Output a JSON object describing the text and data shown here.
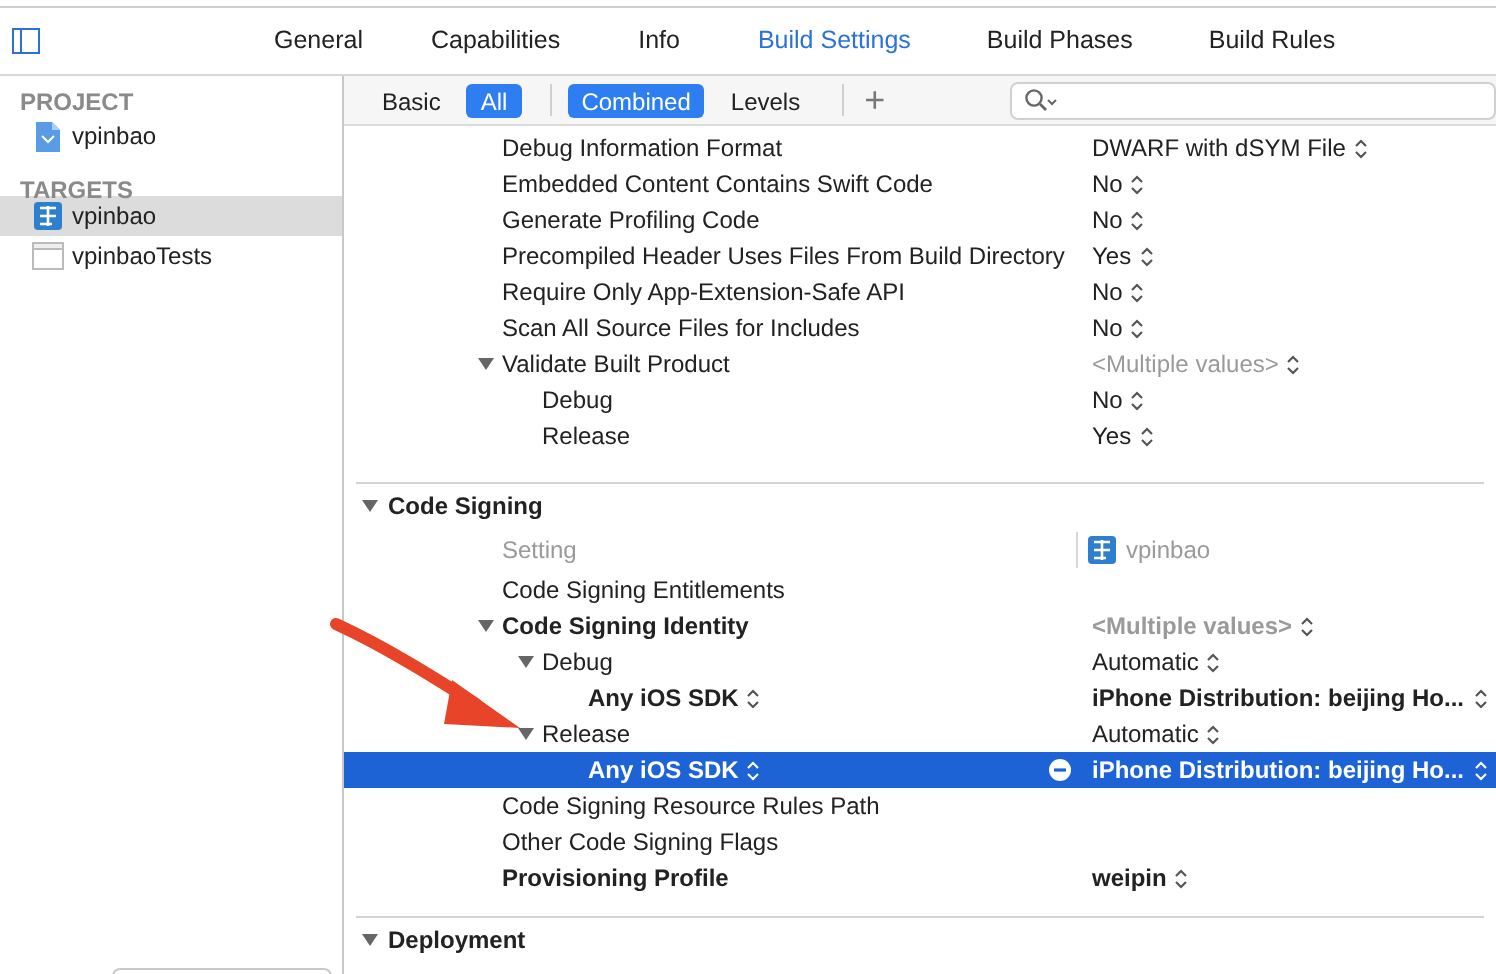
{
  "tabs": [
    {
      "label": "General",
      "selected": false
    },
    {
      "label": "Capabilities",
      "selected": false
    },
    {
      "label": "Info",
      "selected": false
    },
    {
      "label": "Build Settings",
      "selected": true
    },
    {
      "label": "Build Phases",
      "selected": false
    },
    {
      "label": "Build Rules",
      "selected": false
    }
  ],
  "sidebar": {
    "groups": [
      {
        "title": "PROJECT",
        "items": [
          {
            "label": "vpinbao",
            "kind": "project",
            "selected": false
          }
        ]
      },
      {
        "title": "TARGETS",
        "items": [
          {
            "label": "vpinbao",
            "kind": "app",
            "selected": true
          },
          {
            "label": "vpinbaoTests",
            "kind": "tests",
            "selected": false
          }
        ]
      }
    ]
  },
  "filter_bar": {
    "groups": [
      [
        {
          "label": "Basic",
          "selected": false
        },
        {
          "label": "All",
          "selected": true
        }
      ],
      [
        {
          "label": "Combined",
          "selected": true
        },
        {
          "label": "Levels",
          "selected": false
        }
      ]
    ],
    "add_button": "+"
  },
  "sections": [
    {
      "rows": [
        {
          "label": "Debug Information Format",
          "value": "DWARF with dSYM File",
          "selected": false
        },
        {
          "label": "Embedded Content Contains Swift Code",
          "value": "No",
          "selected": false
        },
        {
          "label": "Generate Profiling Code",
          "value": "No",
          "selected": false
        },
        {
          "label": "Precompiled Header Uses Files From Build Directory",
          "value": "Yes",
          "selected": false
        },
        {
          "label": "Require Only App-Extension-Safe API",
          "value": "No",
          "selected": false
        },
        {
          "label": "Scan All Source Files for Includes",
          "value": "No",
          "selected": false
        },
        {
          "label": "Validate Built Product",
          "value": "<Multiple values>",
          "muted": true,
          "expanded": true,
          "selected": false,
          "children": [
            {
              "label": "Debug",
              "value": "No",
              "selected": false
            },
            {
              "label": "Release",
              "value": "Yes",
              "selected": false
            }
          ]
        }
      ]
    },
    {
      "title": "Code Signing",
      "expanded": true,
      "columns": {
        "setting": "Setting",
        "target": "vpinbao"
      },
      "rows": [
        {
          "label": "Code Signing Entitlements",
          "selected": false
        },
        {
          "label": "Code Signing Identity",
          "bold": true,
          "value": "<Multiple values>",
          "muted": true,
          "expanded": true,
          "selected": false,
          "children": [
            {
              "label": "Debug",
              "value": "Automatic",
              "expanded": true,
              "selected": false,
              "children": [
                {
                  "label": "Any iOS SDK",
                  "bold": true,
                  "label_popup": true,
                  "value": "iPhone Distribution: beijing Ho...",
                  "selected": false
                }
              ]
            },
            {
              "label": "Release",
              "value": "Automatic",
              "expanded": true,
              "selected": false,
              "children": [
                {
                  "label": "Any iOS SDK",
                  "bold": true,
                  "label_popup": true,
                  "value": "iPhone Distribution: beijing Ho...",
                  "selected": true
                }
              ]
            }
          ]
        },
        {
          "label": "Code Signing Resource Rules Path",
          "selected": false
        },
        {
          "label": "Other Code Signing Flags",
          "selected": false
        },
        {
          "label": "Provisioning Profile",
          "bold": true,
          "value": "weipin",
          "selected": false
        }
      ]
    },
    {
      "title": "Deployment",
      "expanded": true
    }
  ]
}
